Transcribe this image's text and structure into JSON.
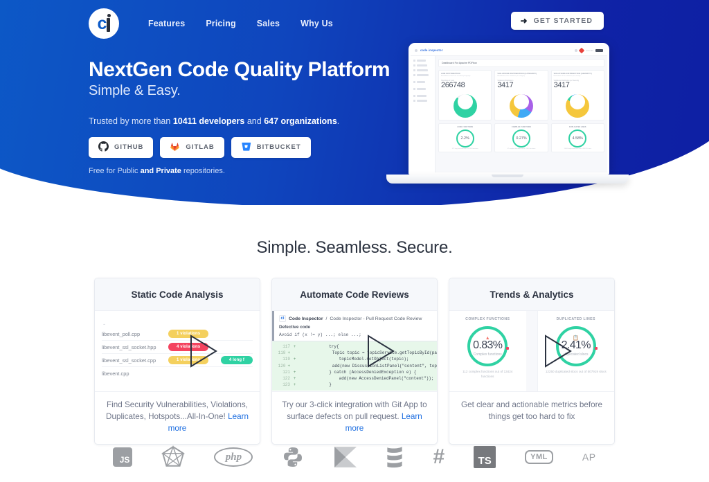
{
  "brand": {
    "name": "ci",
    "logo_icon": "ci-logo-icon"
  },
  "nav": {
    "links": [
      {
        "label": "Features"
      },
      {
        "label": "Pricing"
      },
      {
        "label": "Sales"
      },
      {
        "label": "Why Us"
      }
    ],
    "cta": {
      "label": "GET STARTED",
      "icon": "arrow-right-icon",
      "glyph": "➜"
    }
  },
  "hero": {
    "title": "NextGen Code Quality Platform",
    "subtitle": "Simple & Easy.",
    "trusted_pre": "Trusted by more than ",
    "trusted_developers": "10411 developers",
    "trusted_mid": " and ",
    "trusted_orgs": "647 organizations",
    "trusted_post": ".",
    "repo_buttons": [
      {
        "label": "GITHUB",
        "icon": "github-icon"
      },
      {
        "label": "GITLAB",
        "icon": "gitlab-icon"
      },
      {
        "label": "BITBUCKET",
        "icon": "bitbucket-icon"
      }
    ],
    "free_note_pre": "Free for Public ",
    "free_note_bold": "and Private",
    "free_note_post": " repositories.",
    "colors": {
      "gradient_left": "#0c5bc8",
      "gradient_right": "#0d1fa3",
      "accent": "#1f6fe0"
    }
  },
  "laptop": {
    "app_logo": "code inspector",
    "sidebar_items": [
      "Home",
      "Groups",
      "Projects",
      "Compare",
      "Profile",
      "Log Out",
      "Pricing",
      "Support"
    ],
    "page_title": "Dashboard For Apache PDFbox",
    "metric_cards": [
      {
        "label": "LINE DISTRIBUTION",
        "sub": "Breakdown of the lines of code by language",
        "mini": "Total lines of code",
        "value": "266748",
        "donut_color": "#2fd2a3"
      },
      {
        "label": "VIOLATIONS DISTRIBUTION (CATEGORY)",
        "sub": "Breakdown of the violations per category",
        "mini": "Violations Distribution",
        "value": "3417",
        "donut_color": "#a861e8"
      },
      {
        "label": "VIOLATIONS DISTRIBUTION (SEVERITY)",
        "sub": "Breakdown of the violations per severity",
        "mini": "Violations Distribution per Severity",
        "value": "3417",
        "donut_color": "#f5c73c"
      }
    ],
    "small_cards": [
      {
        "label": "LONG FUNCTIONS",
        "value": "2.2%",
        "caption": "long functions",
        "foot": "377 long functions out of 17459 functions"
      },
      {
        "label": "COMPLEX FUNCTIONS",
        "value": "0.27%",
        "caption": "complex functions",
        "foot": "47 complex functions out of 17459 functions"
      },
      {
        "label": "DUPLICATED LINES",
        "value": "4.58%",
        "caption": "duplicated slocs",
        "foot": "11091 duplicated slocs out of 242219 slocs"
      }
    ]
  },
  "features": {
    "section_title": "Simple. Seamless. Secure.",
    "cards": [
      {
        "title": "Static Code Analysis",
        "footer_text": "Find Security Vulnerabilities, Violations, Duplicates, Hotspots...All-In-One! ",
        "footer_link": "Learn more",
        "play_icon": "play-icon",
        "violations": [
          {
            "file": "libevent_poll.cpp",
            "badge": "1 violations",
            "badge_type": "y",
            "extra": ""
          },
          {
            "file": "libevent_ssl_socket.hpp",
            "badge": "4 violations",
            "badge_type": "r",
            "extra": ""
          },
          {
            "file": "libevent_ssl_socket.cpp",
            "badge": "1 violations",
            "badge_type": "y",
            "extra": "4 long f"
          },
          {
            "file": "libevent.cpp",
            "badge": "",
            "badge_type": "",
            "extra": ""
          }
        ]
      },
      {
        "title": "Automate Code Reviews",
        "footer_text": "Try our 3-click integration with Git App to surface defects on pull request. ",
        "footer_link": "Learn more",
        "play_icon": "play-icon",
        "pr": {
          "repo": "Code Inspector",
          "separator": " / ",
          "branch": "Code Inspector - Pull Request Code Review",
          "defect_label": "Defective code",
          "advice": "Avoid if (x != y) ...; else ...;",
          "diff": [
            {
              "num": "117",
              "sign": "+",
              "code": "            try{"
            },
            {
              "num": "118",
              "sign": "+",
              "code": "                Topic topic = topicService.getTopicById(pa"
            },
            {
              "num": "119",
              "sign": "+",
              "code": "                topicModel.setObject(topic);"
            },
            {
              "num": "120",
              "sign": "+",
              "code": "                add(new DiscussionListPanel(\"content\", top"
            },
            {
              "num": "121",
              "sign": "+",
              "code": "            } catch (AccessDeniedException e) {"
            },
            {
              "num": "122",
              "sign": "+",
              "code": "                add(new AccessDeniedPanel(\"content\"));"
            },
            {
              "num": "123",
              "sign": "+",
              "code": "            }"
            }
          ]
        }
      },
      {
        "title": "Trends & Analytics",
        "footer_text": "Get clear and actionable metrics before things get too hard to fix",
        "footer_link": "",
        "play_icon": "play-icon",
        "trends": [
          {
            "label": "COMPLEX FUNCTIONS",
            "icon": "warning-icon",
            "value": "0.83%",
            "caption": "Complex functions",
            "foot": "112 complex functions out of 13424 functions"
          },
          {
            "label": "DUPLICATED LINES",
            "icon": "copy-icon",
            "value": "2.41%",
            "caption": "duplicated slocs",
            "foot": "12250 duplicated slocs out of 507919 slocs"
          }
        ]
      }
    ]
  },
  "tech_logos": [
    {
      "name": "javascript-icon",
      "label": "JS"
    },
    {
      "name": "ruby-icon",
      "label": ""
    },
    {
      "name": "php-icon",
      "label": "php"
    },
    {
      "name": "python-icon",
      "label": ""
    },
    {
      "name": "kotlin-icon",
      "label": ""
    },
    {
      "name": "scala-icon",
      "label": ""
    },
    {
      "name": "csharp-icon",
      "label": "#"
    },
    {
      "name": "typescript-icon",
      "label": "TS"
    },
    {
      "name": "yaml-icon",
      "label": "YML"
    },
    {
      "name": "apex-icon",
      "label": "AP"
    }
  ]
}
